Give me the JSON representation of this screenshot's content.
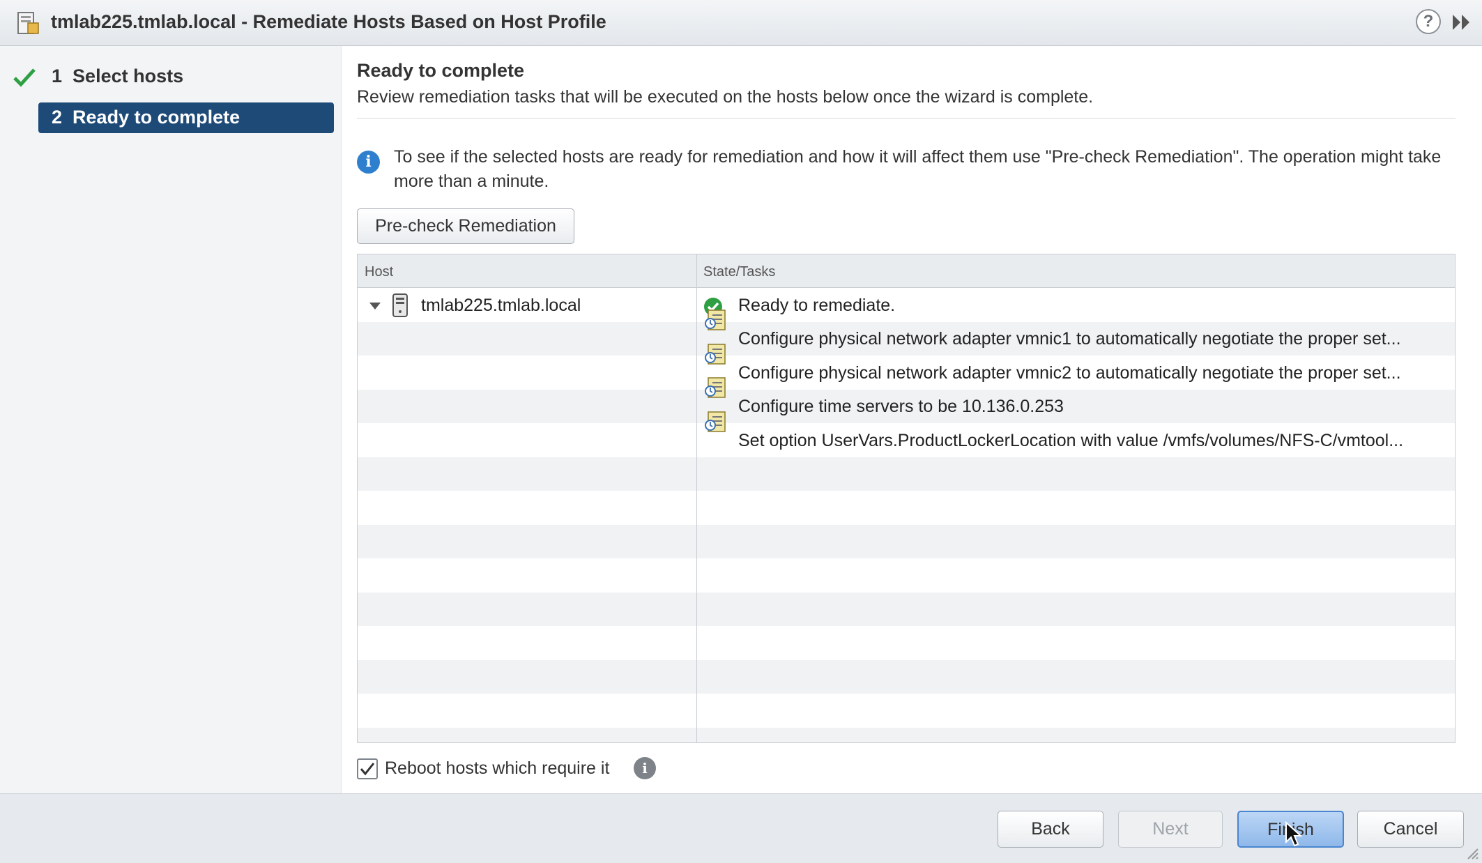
{
  "window": {
    "title": "tmlab225.tmlab.local - Remediate Hosts Based on Host Profile",
    "help_label": "?"
  },
  "steps": [
    {
      "number": "1",
      "label": "Select hosts",
      "status": "completed"
    },
    {
      "number": "2",
      "label": "Ready to complete",
      "status": "current"
    }
  ],
  "main": {
    "heading": "Ready to complete",
    "subheading": "Review remediation tasks that will be executed on the hosts below once the wizard is complete.",
    "info_text": "To see if the selected hosts are ready for remediation and how it will affect them use \"Pre-check Remediation\". The operation might take more than a minute.",
    "precheck_label": "Pre-check Remediation"
  },
  "table": {
    "columns": [
      "Host",
      "State/Tasks"
    ],
    "host": "tmlab225.tmlab.local",
    "status": "Ready to remediate.",
    "tasks": [
      "Configure physical network adapter vmnic1 to automatically negotiate the proper set...",
      "Configure physical network adapter vmnic2 to automatically negotiate the proper set...",
      "Configure time servers to be 10.136.0.253",
      "Set option UserVars.ProductLockerLocation with value /vmfs/volumes/NFS-C/vmtool..."
    ]
  },
  "reboot": {
    "label": "Reboot hosts which require it",
    "checked": true
  },
  "footer": {
    "back": "Back",
    "next": "Next",
    "finish": "Finish",
    "cancel": "Cancel"
  },
  "colors": {
    "accent": "#1e4a78",
    "success": "#2ea043",
    "info": "#2f7fcf"
  }
}
